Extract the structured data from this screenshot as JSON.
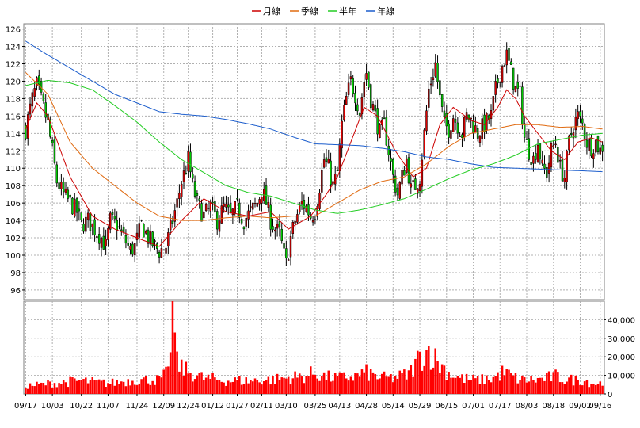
{
  "chart_data": {
    "type": "candlestick",
    "legend": {
      "placement": "top-center",
      "items": [
        {
          "label": "月線",
          "color": "#cc0000"
        },
        {
          "label": "季線",
          "color": "#e06a10"
        },
        {
          "label": "半年",
          "color": "#22cc22"
        },
        {
          "label": "年線",
          "color": "#1a5ccc"
        }
      ]
    },
    "price_axis": {
      "min": 96,
      "max": 126,
      "ticks": [
        "96",
        "98",
        "100",
        "102",
        "104",
        "106",
        "108",
        "110",
        "112",
        "114",
        "116",
        "118",
        "120",
        "122",
        "124",
        "126"
      ]
    },
    "volume_axis": {
      "min": 0,
      "max": 50000,
      "ticks": [
        {
          "value": 0,
          "label": "0"
        },
        {
          "value": 10000,
          "label": "10,000"
        },
        {
          "value": 20000,
          "label": "20,000"
        },
        {
          "value": 30000,
          "label": "30,000"
        },
        {
          "value": 40000,
          "label": "40,000"
        }
      ]
    },
    "x_labels": [
      {
        "i": 0,
        "label": "09/17"
      },
      {
        "i": 12,
        "label": "10/03"
      },
      {
        "i": 25,
        "label": "10/22"
      },
      {
        "i": 37,
        "label": "11/07"
      },
      {
        "i": 50,
        "label": "11/24"
      },
      {
        "i": 62,
        "label": "12/09"
      },
      {
        "i": 73,
        "label": "12/24"
      },
      {
        "i": 84,
        "label": "01/12"
      },
      {
        "i": 95,
        "label": "01/27"
      },
      {
        "i": 106,
        "label": "02/11"
      },
      {
        "i": 117,
        "label": "03/10"
      },
      {
        "i": 130,
        "label": "03/25"
      },
      {
        "i": 141,
        "label": "04/13"
      },
      {
        "i": 153,
        "label": "04/28"
      },
      {
        "i": 165,
        "label": "05/14"
      },
      {
        "i": 177,
        "label": "05/29"
      },
      {
        "i": 189,
        "label": "06/15"
      },
      {
        "i": 201,
        "label": "07/01"
      },
      {
        "i": 213,
        "label": "07/17"
      },
      {
        "i": 225,
        "label": "08/03"
      },
      {
        "i": 237,
        "label": "08/18"
      },
      {
        "i": 249,
        "label": "09/02"
      },
      {
        "i": 258,
        "label": "09/16"
      }
    ],
    "n_days": 260,
    "close_path": [
      [
        0,
        114.5
      ],
      [
        3,
        118
      ],
      [
        5,
        119.5
      ],
      [
        8,
        117
      ],
      [
        10,
        115
      ],
      [
        12,
        112
      ],
      [
        14,
        108.5
      ],
      [
        17,
        107
      ],
      [
        20,
        106
      ],
      [
        23,
        105
      ],
      [
        25,
        103.5
      ],
      [
        28,
        104
      ],
      [
        31,
        103
      ],
      [
        34,
        102
      ],
      [
        36,
        101
      ],
      [
        38,
        104
      ],
      [
        41,
        103.5
      ],
      [
        44,
        102
      ],
      [
        47,
        100.5
      ],
      [
        49,
        101
      ],
      [
        52,
        103.5
      ],
      [
        55,
        102
      ],
      [
        58,
        101
      ],
      [
        60,
        100.5
      ],
      [
        63,
        101
      ],
      [
        66,
        104
      ],
      [
        68,
        106
      ],
      [
        70,
        108.5
      ],
      [
        72,
        110
      ],
      [
        73,
        111
      ],
      [
        75,
        108
      ],
      [
        77,
        106
      ],
      [
        80,
        104.5
      ],
      [
        83,
        105.5
      ],
      [
        86,
        104
      ],
      [
        89,
        105.5
      ],
      [
        92,
        104.5
      ],
      [
        95,
        105.5
      ],
      [
        98,
        104
      ],
      [
        101,
        105
      ],
      [
        104,
        106
      ],
      [
        106,
        107.5
      ],
      [
        108,
        106
      ],
      [
        110,
        104
      ],
      [
        112,
        103
      ],
      [
        114,
        102.5
      ],
      [
        116,
        100
      ],
      [
        117,
        99
      ],
      [
        119,
        102
      ],
      [
        121,
        104
      ],
      [
        124,
        106
      ],
      [
        126,
        105.5
      ],
      [
        128,
        104.5
      ],
      [
        130,
        105
      ],
      [
        132,
        108
      ],
      [
        134,
        111
      ],
      [
        136,
        110
      ],
      [
        138,
        108
      ],
      [
        140,
        109.5
      ],
      [
        142,
        115
      ],
      [
        144,
        118
      ],
      [
        146,
        120
      ],
      [
        148,
        118.5
      ],
      [
        150,
        116.5
      ],
      [
        152,
        120
      ],
      [
        153,
        121
      ],
      [
        155,
        118
      ],
      [
        157,
        116
      ],
      [
        159,
        114
      ],
      [
        161,
        115
      ],
      [
        163,
        112
      ],
      [
        165,
        109
      ],
      [
        167,
        107
      ],
      [
        169,
        109
      ],
      [
        171,
        111
      ],
      [
        173,
        107.5
      ],
      [
        175,
        108
      ],
      [
        177,
        109
      ],
      [
        179,
        114
      ],
      [
        181,
        119
      ],
      [
        183,
        121
      ],
      [
        184,
        122
      ],
      [
        186,
        118
      ],
      [
        188,
        115
      ],
      [
        190,
        114.5
      ],
      [
        192,
        116
      ],
      [
        194,
        115
      ],
      [
        196,
        114
      ],
      [
        198,
        116
      ],
      [
        200,
        115.5
      ],
      [
        203,
        114
      ],
      [
        206,
        115
      ],
      [
        209,
        116
      ],
      [
        211,
        119
      ],
      [
        213,
        121
      ],
      [
        215,
        122.5
      ],
      [
        216,
        123
      ],
      [
        218,
        121
      ],
      [
        220,
        119
      ],
      [
        222,
        118.5
      ],
      [
        224,
        113.5
      ],
      [
        226,
        112
      ],
      [
        228,
        111
      ],
      [
        230,
        113
      ],
      [
        232,
        110
      ],
      [
        234,
        109.5
      ],
      [
        236,
        112
      ],
      [
        238,
        113
      ],
      [
        240,
        110
      ],
      [
        242,
        109
      ],
      [
        244,
        113
      ],
      [
        246,
        115
      ],
      [
        248,
        116
      ],
      [
        250,
        115
      ],
      [
        252,
        113
      ],
      [
        254,
        112.5
      ],
      [
        256,
        113
      ],
      [
        258,
        112
      ],
      [
        259,
        112.5
      ]
    ],
    "ma_month": [
      [
        0,
        114.5
      ],
      [
        5,
        117.5
      ],
      [
        10,
        116
      ],
      [
        20,
        109
      ],
      [
        30,
        104.5
      ],
      [
        40,
        103
      ],
      [
        50,
        102
      ],
      [
        60,
        101
      ],
      [
        70,
        104
      ],
      [
        80,
        106.5
      ],
      [
        90,
        105
      ],
      [
        100,
        104.5
      ],
      [
        110,
        105
      ],
      [
        118,
        103
      ],
      [
        128,
        104.5
      ],
      [
        135,
        107
      ],
      [
        140,
        109
      ],
      [
        146,
        113
      ],
      [
        152,
        117
      ],
      [
        158,
        116
      ],
      [
        166,
        112
      ],
      [
        174,
        109
      ],
      [
        180,
        110
      ],
      [
        186,
        115
      ],
      [
        192,
        117
      ],
      [
        200,
        115.5
      ],
      [
        206,
        115
      ],
      [
        212,
        117
      ],
      [
        216,
        119
      ],
      [
        220,
        118
      ],
      [
        224,
        116
      ],
      [
        230,
        114
      ],
      [
        236,
        112
      ],
      [
        242,
        111
      ],
      [
        248,
        113
      ],
      [
        254,
        113.5
      ],
      [
        259,
        113
      ]
    ],
    "ma_quarter": [
      [
        0,
        121
      ],
      [
        10,
        118.5
      ],
      [
        20,
        113
      ],
      [
        30,
        110
      ],
      [
        40,
        108
      ],
      [
        50,
        106
      ],
      [
        60,
        104.5
      ],
      [
        70,
        104
      ],
      [
        80,
        104
      ],
      [
        90,
        104.3
      ],
      [
        100,
        104.5
      ],
      [
        110,
        104.3
      ],
      [
        120,
        104.5
      ],
      [
        130,
        104.5
      ],
      [
        140,
        106
      ],
      [
        150,
        107.5
      ],
      [
        160,
        108.5
      ],
      [
        170,
        109
      ],
      [
        180,
        110.5
      ],
      [
        190,
        112.5
      ],
      [
        200,
        114
      ],
      [
        210,
        114.5
      ],
      [
        220,
        115
      ],
      [
        230,
        115
      ],
      [
        240,
        114.7
      ],
      [
        250,
        114.8
      ],
      [
        259,
        114.5
      ]
    ],
    "ma_half": [
      [
        0,
        119.5
      ],
      [
        10,
        120.1
      ],
      [
        20,
        119.8
      ],
      [
        30,
        119
      ],
      [
        40,
        117.2
      ],
      [
        50,
        115.3
      ],
      [
        60,
        113
      ],
      [
        70,
        111
      ],
      [
        80,
        109.5
      ],
      [
        90,
        108
      ],
      [
        100,
        107.2
      ],
      [
        110,
        106.8
      ],
      [
        120,
        106
      ],
      [
        130,
        105.2
      ],
      [
        140,
        104.8
      ],
      [
        150,
        105.2
      ],
      [
        160,
        105.8
      ],
      [
        170,
        106.5
      ],
      [
        180,
        107.6
      ],
      [
        190,
        108.8
      ],
      [
        200,
        109.8
      ],
      [
        210,
        110.5
      ],
      [
        220,
        111.5
      ],
      [
        230,
        112.8
      ],
      [
        240,
        113.3
      ],
      [
        250,
        113.8
      ],
      [
        259,
        114
      ]
    ],
    "ma_year": [
      [
        0,
        124.6
      ],
      [
        10,
        123
      ],
      [
        20,
        121.5
      ],
      [
        30,
        120
      ],
      [
        40,
        118.5
      ],
      [
        50,
        117.5
      ],
      [
        60,
        116.5
      ],
      [
        70,
        116.2
      ],
      [
        80,
        116
      ],
      [
        90,
        115.6
      ],
      [
        100,
        115.1
      ],
      [
        110,
        114.5
      ],
      [
        120,
        113.6
      ],
      [
        130,
        112.8
      ],
      [
        140,
        112.7
      ],
      [
        150,
        112.6
      ],
      [
        160,
        112.3
      ],
      [
        170,
        111.9
      ],
      [
        180,
        111.3
      ],
      [
        190,
        111
      ],
      [
        200,
        110.5
      ],
      [
        210,
        110.1
      ],
      [
        220,
        110
      ],
      [
        230,
        109.9
      ],
      [
        240,
        109.8
      ],
      [
        250,
        109.7
      ],
      [
        259,
        109.6
      ]
    ],
    "volume_profile": [
      [
        0,
        4500
      ],
      [
        12,
        6000
      ],
      [
        25,
        7500
      ],
      [
        37,
        6000
      ],
      [
        50,
        8000
      ],
      [
        60,
        8000
      ],
      [
        64,
        12000
      ],
      [
        66,
        52000
      ],
      [
        68,
        17000
      ],
      [
        72,
        13000
      ],
      [
        80,
        9000
      ],
      [
        90,
        7500
      ],
      [
        100,
        7500
      ],
      [
        110,
        8000
      ],
      [
        117,
        9000
      ],
      [
        125,
        10000
      ],
      [
        130,
        12000
      ],
      [
        135,
        9500
      ],
      [
        141,
        9000
      ],
      [
        148,
        10000
      ],
      [
        153,
        12000
      ],
      [
        160,
        9000
      ],
      [
        165,
        9000
      ],
      [
        172,
        11000
      ],
      [
        177,
        21000
      ],
      [
        181,
        25000
      ],
      [
        185,
        18000
      ],
      [
        190,
        12000
      ],
      [
        195,
        9000
      ],
      [
        200,
        8000
      ],
      [
        205,
        8000
      ],
      [
        210,
        9000
      ],
      [
        214,
        12000
      ],
      [
        217,
        11000
      ],
      [
        222,
        8000
      ],
      [
        230,
        8000
      ],
      [
        238,
        10000
      ],
      [
        243,
        8000
      ],
      [
        250,
        8000
      ],
      [
        255,
        6000
      ],
      [
        259,
        6000
      ]
    ]
  }
}
